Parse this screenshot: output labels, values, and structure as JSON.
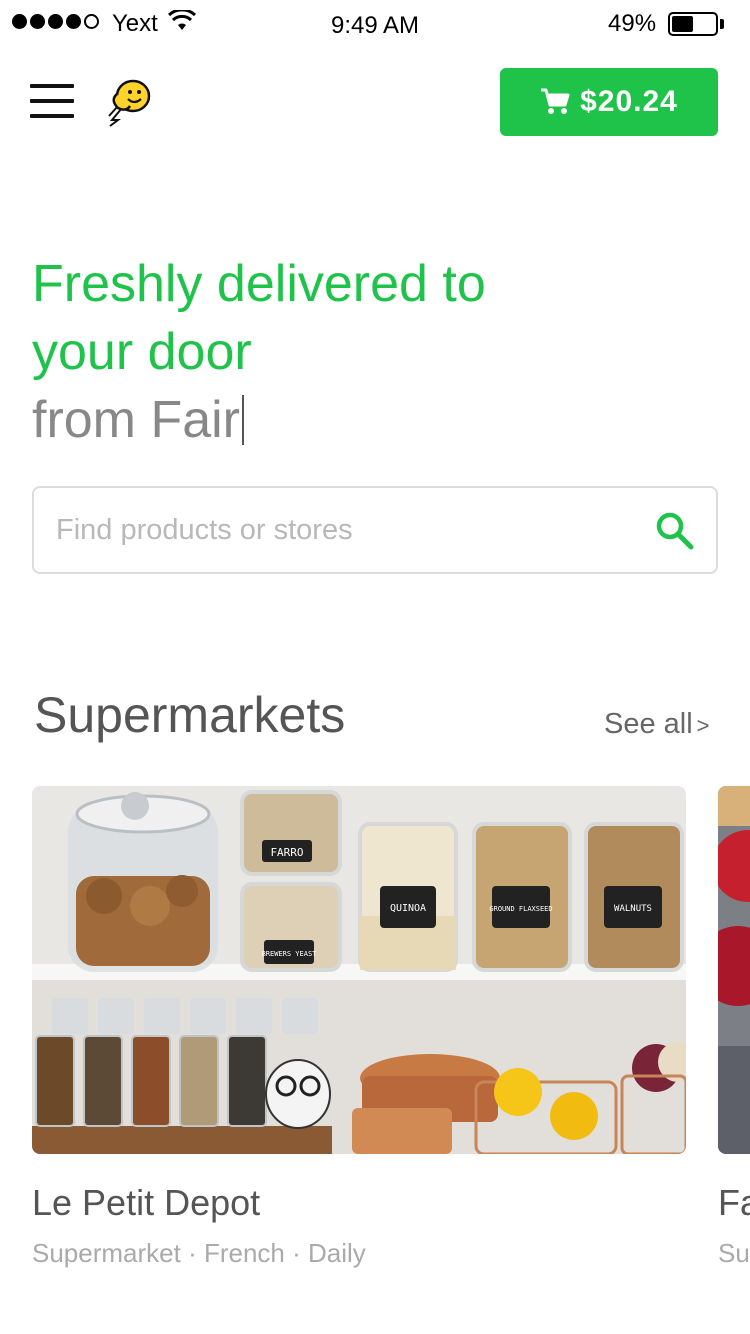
{
  "status_bar": {
    "carrier": "Yext",
    "time": "9:49 AM",
    "battery_percent": "49%",
    "battery_level": 0.49,
    "signal_bars": 3
  },
  "header": {
    "menu_icon": "hamburger-menu-icon",
    "logo_icon": "bee-logo-icon",
    "cart_icon": "shopping-cart-icon",
    "cart_amount": "$20.24"
  },
  "hero": {
    "line1": "Freshly delivered to",
    "line2": "your door",
    "line3": "from Fair"
  },
  "search": {
    "placeholder": "Find products or stores",
    "value": "",
    "icon": "search-icon"
  },
  "section": {
    "title": "Supermarkets",
    "see_all": "See all",
    "see_all_icon": "chevron-right-icon"
  },
  "stores": [
    {
      "name": "Le Petit Depot",
      "meta": "Supermarket · French ·  Daily",
      "jar_labels": [
        "FARRO",
        "BREWERS YEAST",
        "QUINOA",
        "GROUND FLAXSEED",
        "WALNUTS"
      ]
    },
    {
      "name": "Fa",
      "meta": "Su"
    }
  ],
  "colors": {
    "brand_green": "#1fc34a",
    "hero_gray": "#888888",
    "title_gray": "#555555"
  }
}
